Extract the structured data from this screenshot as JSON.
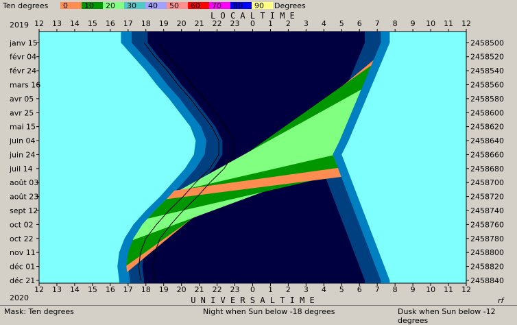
{
  "header": {
    "mask_label": "Ten degrees",
    "unit_label": "Degrees",
    "legend": [
      {
        "label": "0",
        "color": "#ff8c50"
      },
      {
        "label": "10",
        "color": "#009600"
      },
      {
        "label": "20",
        "color": "#80ff80"
      },
      {
        "label": "30",
        "color": "#50c8c8"
      },
      {
        "label": "40",
        "color": "#a0a0ff"
      },
      {
        "label": "50",
        "color": "#ff9090"
      },
      {
        "label": "60",
        "color": "#ff0000"
      },
      {
        "label": "70",
        "color": "#ff00ff"
      },
      {
        "label": "80",
        "color": "#0000ff"
      },
      {
        "label": "90",
        "color": "#ffff80"
      }
    ]
  },
  "years": {
    "top": "2019",
    "bottom": "2020"
  },
  "axis_titles": {
    "top": "L O C A L   T I M E",
    "bottom": "U N I V E R S A L   T I M E"
  },
  "corner_label": "rf",
  "status": {
    "left": "Mask:  Ten degrees",
    "center": "Night when Sun below -18 degrees",
    "right": "Dusk when Sun below -12 degrees"
  },
  "chart_data": {
    "type": "area",
    "x_ticks_top": [
      "12",
      "13",
      "14",
      "15",
      "16",
      "17",
      "18",
      "19",
      "20",
      "21",
      "22",
      "23",
      "0",
      "1",
      "2",
      "3",
      "4",
      "5",
      "6",
      "7",
      "8",
      "9",
      "10",
      "11",
      "12"
    ],
    "x_ticks_bottom": [
      "12",
      "13",
      "14",
      "15",
      "16",
      "17",
      "18",
      "19",
      "20",
      "21",
      "22",
      "23",
      "0",
      "1",
      "2",
      "3",
      "4",
      "5",
      "6",
      "7",
      "8",
      "9",
      "10",
      "11",
      "12"
    ],
    "y_labels_left": [
      "janv 15",
      "févr 04",
      "févr 24",
      "mars 16",
      "avr 05",
      "avr 25",
      "mai 15",
      "juin 04",
      "juin 24",
      "juil 14",
      "août 03",
      "août 23",
      "sept 12",
      "oct 02",
      "oct 22",
      "nov 11",
      "déc 01",
      "déc 21"
    ],
    "y_labels_right": [
      "2458500",
      "2458520",
      "2458540",
      "2458560",
      "2458580",
      "2458600",
      "2458620",
      "2458640",
      "2458660",
      "2458680",
      "2458700",
      "2458720",
      "2458740",
      "2458760",
      "2458780",
      "2458800",
      "2458820",
      "2458840"
    ],
    "colors": {
      "day": "#80ffff",
      "dusk": "#0080c0",
      "dark_dusk": "#004080",
      "night": "#000040"
    },
    "regions": {
      "dusk_evening_hour": [
        16.6,
        17.3,
        18.0,
        18.6,
        19.3,
        19.9,
        20.5,
        20.8,
        20.7,
        20.2,
        19.5,
        18.8,
        18.0,
        17.3,
        16.8,
        16.5,
        16.4,
        16.5
      ],
      "night_evening_hour": [
        18.1,
        18.7,
        19.4,
        20.0,
        20.7,
        21.3,
        21.9,
        22.3,
        22.3,
        21.8,
        21.0,
        20.3,
        19.5,
        18.8,
        18.2,
        17.9,
        17.8,
        17.9
      ]
    }
  }
}
